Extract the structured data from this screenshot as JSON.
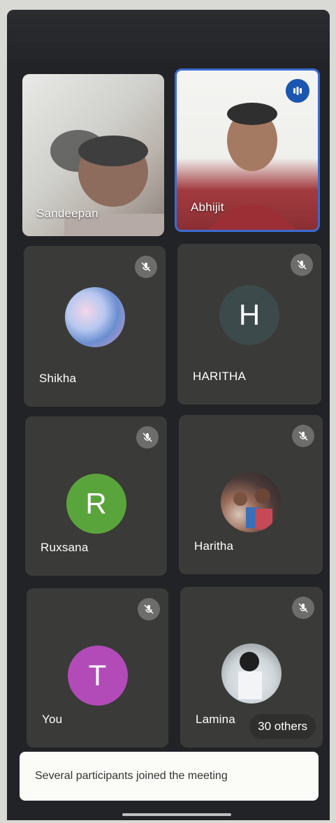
{
  "participants": [
    {
      "name": "Sandeepan",
      "type": "video"
    },
    {
      "name": "Abhijit",
      "type": "video",
      "speaking": true
    },
    {
      "name": "Shikha",
      "type": "photo",
      "muted": true
    },
    {
      "name": "HARITHA",
      "type": "initial",
      "initial": "H",
      "color": "#3d4a4b",
      "muted": true
    },
    {
      "name": "Ruxsana",
      "type": "initial",
      "initial": "R",
      "color": "#5aa53b",
      "muted": true
    },
    {
      "name": "Haritha",
      "type": "photo",
      "muted": true
    },
    {
      "name": "You",
      "type": "initial",
      "initial": "T",
      "color": "#b24bb8",
      "muted": true
    },
    {
      "name": "Lamina",
      "type": "photo",
      "muted": true
    }
  ],
  "others_label": "30 others",
  "toast": {
    "message": "Several participants joined the meeting"
  },
  "icons": {
    "muted": "mic-off-icon",
    "speaking": "audio-level-icon"
  },
  "colors": {
    "background": "#212327",
    "tile": "#3a3a38",
    "speaking_border": "#3b6bd0"
  }
}
